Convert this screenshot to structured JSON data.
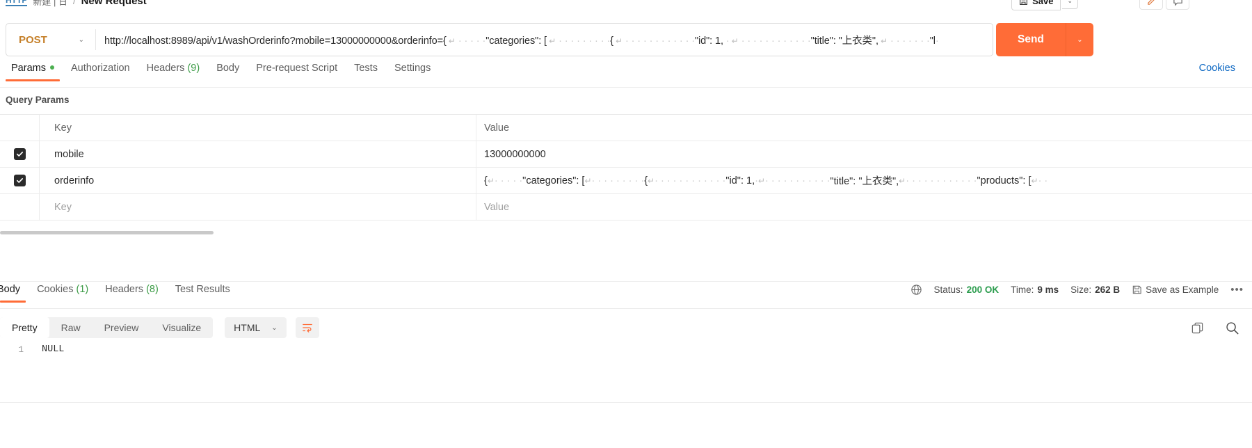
{
  "breadcrumb": {
    "logo": "HTTP",
    "collection": "新建 | 日",
    "separator": "/",
    "title": "New Request"
  },
  "toolbar": {
    "save_label": "Save",
    "save_caret": "⌄",
    "edit_icon": "pencil-icon",
    "comment_icon": "comment-icon"
  },
  "request": {
    "method": "POST",
    "method_caret": "⌄",
    "url_prefix": "http://localhost:8989/api/v1/washOrderinfo?mobile=13000000000&orderinfo={",
    "url_seg_categories": "\"categories\": [",
    "url_seg_brace": "{",
    "url_seg_id": "\"id\": 1,",
    "url_seg_title": "\"title\": \"上衣类\",",
    "url_seg_tail": "\"l",
    "send_label": "Send",
    "send_caret": "⌄"
  },
  "request_tabs": [
    {
      "label": "Params",
      "active": true,
      "dot": true
    },
    {
      "label": "Authorization",
      "active": false
    },
    {
      "label": "Headers",
      "active": false,
      "count": "(9)"
    },
    {
      "label": "Body",
      "active": false
    },
    {
      "label": "Pre-request Script",
      "active": false
    },
    {
      "label": "Tests",
      "active": false
    },
    {
      "label": "Settings",
      "active": false
    }
  ],
  "cookies_link": "Cookies",
  "query_params": {
    "section_title": "Query Params",
    "headers": {
      "key": "Key",
      "value": "Value"
    },
    "rows": [
      {
        "checked": true,
        "key": "mobile",
        "value": "13000000000",
        "placeholder": false
      },
      {
        "checked": true,
        "key": "orderinfo",
        "value_segments": [
          "{",
          "\"categories\": [",
          "{",
          "\"id\": 1,",
          "\"title\": \"上衣类\",",
          "\"products\": ["
        ],
        "placeholder": false
      },
      {
        "checked": false,
        "key": "Key",
        "value": "Value",
        "placeholder": true
      }
    ]
  },
  "response_tabs": [
    {
      "label": "Body",
      "active": true
    },
    {
      "label": "Cookies",
      "active": false,
      "count": "(1)"
    },
    {
      "label": "Headers",
      "active": false,
      "count": "(8)"
    },
    {
      "label": "Test Results",
      "active": false
    }
  ],
  "response_meta": {
    "globe_icon": "globe-icon",
    "status_label": "Status:",
    "status_value": "200 OK",
    "time_label": "Time:",
    "time_value": "9 ms",
    "size_label": "Size:",
    "size_value": "262 B",
    "save_example_icon": "save-icon",
    "save_example_label": "Save as Example",
    "more_icon": "more-options-icon"
  },
  "viewer": {
    "modes": [
      {
        "label": "Pretty",
        "active": true
      },
      {
        "label": "Raw",
        "active": false
      },
      {
        "label": "Preview",
        "active": false
      },
      {
        "label": "Visualize",
        "active": false
      }
    ],
    "format": "HTML",
    "format_caret": "⌄",
    "wrap_icon": "wrap-lines-icon",
    "copy_icon": "copy-icon",
    "search_icon": "search-icon"
  },
  "body_content": {
    "lines": [
      {
        "number": "1",
        "text": "NULL"
      }
    ]
  },
  "colors": {
    "accent": "#ff6c37",
    "method": "#c5802a",
    "link": "#0a66c2",
    "success": "#2d9d4f",
    "count": "#3d9c47"
  }
}
